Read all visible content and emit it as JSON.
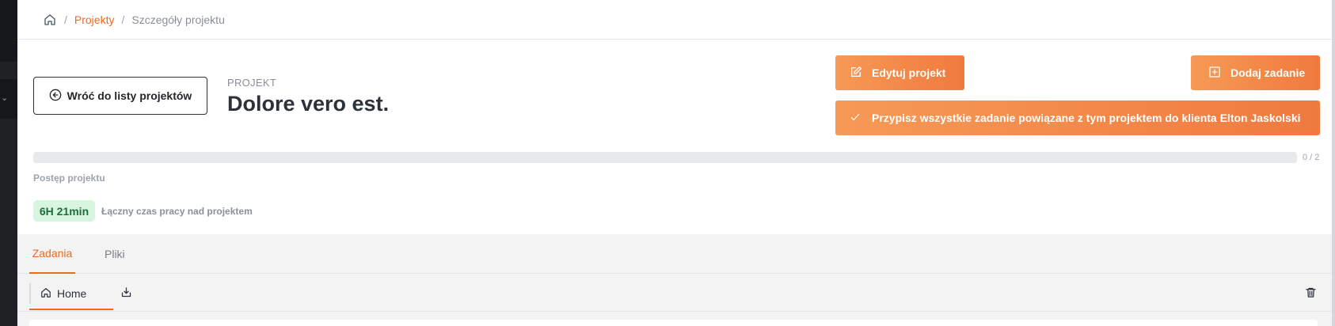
{
  "breadcrumb": {
    "home_icon": "home-icon",
    "separator": "/",
    "projects": "Projekty",
    "current": "Szczegóły projektu"
  },
  "header": {
    "back_label": "Wróć do listy projektów",
    "project_label": "PROJEKT",
    "project_title": "Dolore vero est.",
    "edit_label": "Edytuj projekt",
    "add_task_label": "Dodaj zadanie",
    "assign_label": "Przypisz wszystkie zadanie powiązane z tym projektem do klienta Elton Jaskolski"
  },
  "progress": {
    "fraction": 0,
    "count_text": "0 / 2",
    "label": "Postęp projektu"
  },
  "time": {
    "badge": "6H 21min",
    "label": "Łączny czas pracy nad projektem"
  },
  "tabs": [
    {
      "label": "Zadania",
      "active": true
    },
    {
      "label": "Pliki",
      "active": false
    }
  ],
  "folder": {
    "home_label": "Home"
  },
  "colors": {
    "accent": "#ec6a1f",
    "button_gradient_start": "#f69a55",
    "button_gradient_end": "#f07a3e",
    "badge_bg": "#d8f5df",
    "badge_text": "#1d6f3a"
  }
}
